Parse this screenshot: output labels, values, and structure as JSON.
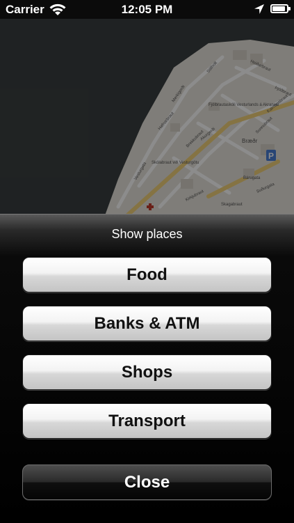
{
  "status_bar": {
    "carrier": "Carrier",
    "time": "12:05 PM",
    "icons": [
      "wifi-icon",
      "location-arrow-icon",
      "battery-icon"
    ],
    "battery_level": 0.9
  },
  "map": {
    "labels": [
      "Fjölbrautaskóli Vesturlands á Akranesi",
      "Skólabraut við Vesturgötu",
      "Skagabraut",
      "Kirkjubraut",
      "Vesturgata",
      "Stillholt",
      "Heiðarbraut",
      "Sunnubraut",
      "Merkigerði",
      "Bárugata",
      "Hafnarbraut",
      "Kalmansbraut",
      "Brekkubraut",
      "Akurgerði",
      "Þjóðbraut",
      "Suðurgata"
    ],
    "places": [
      "Bræðr"
    ],
    "markers": [
      "pharmacy-cross-icon",
      "parking-icon"
    ]
  },
  "sheet": {
    "title": "Show places",
    "buttons": [
      "Food",
      "Banks & ATM",
      "Shops",
      "Transport"
    ],
    "close_label": "Close"
  },
  "colors": {
    "sheet_background": "#000000",
    "light_button": "#e6e6e6",
    "dark_button": "#1a1a1a"
  }
}
